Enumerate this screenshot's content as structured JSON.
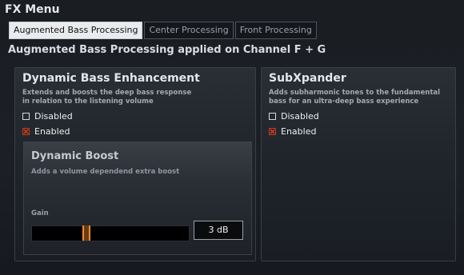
{
  "menu_title": "FX Menu",
  "tabs": [
    {
      "label": "Augmented Bass Processing",
      "active": true
    },
    {
      "label": "Center Processing",
      "active": false
    },
    {
      "label": "Front Processing",
      "active": false
    }
  ],
  "section_heading": "Augmented Bass Processing applied on Channel F + G",
  "dbe": {
    "title": "Dynamic Bass Enhancement",
    "description_line1": "Extends and boosts the deep bass response",
    "description_line2": "in relation to the listening volume",
    "disabled_label": "Disabled",
    "enabled_label": "Enabled",
    "selected": "Enabled"
  },
  "dynamic_boost": {
    "title": "Dynamic Boost",
    "description": "Adds a volume dependend extra boost",
    "gain_label": "Gain",
    "gain_value": "3 dB"
  },
  "subxpander": {
    "title": "SubXpander",
    "description_line1": "Adds subharmonic tones to the fundamental",
    "description_line2": "bass for an ultra-deep bass experience",
    "disabled_label": "Disabled",
    "enabled_label": "Enabled",
    "selected": "Enabled"
  },
  "colors": {
    "accent_orange": "#ff8a2a",
    "checkbox_x": "#d23a1a"
  },
  "icons": {
    "checked": "x-mark-icon",
    "unchecked": "empty-checkbox-icon"
  }
}
